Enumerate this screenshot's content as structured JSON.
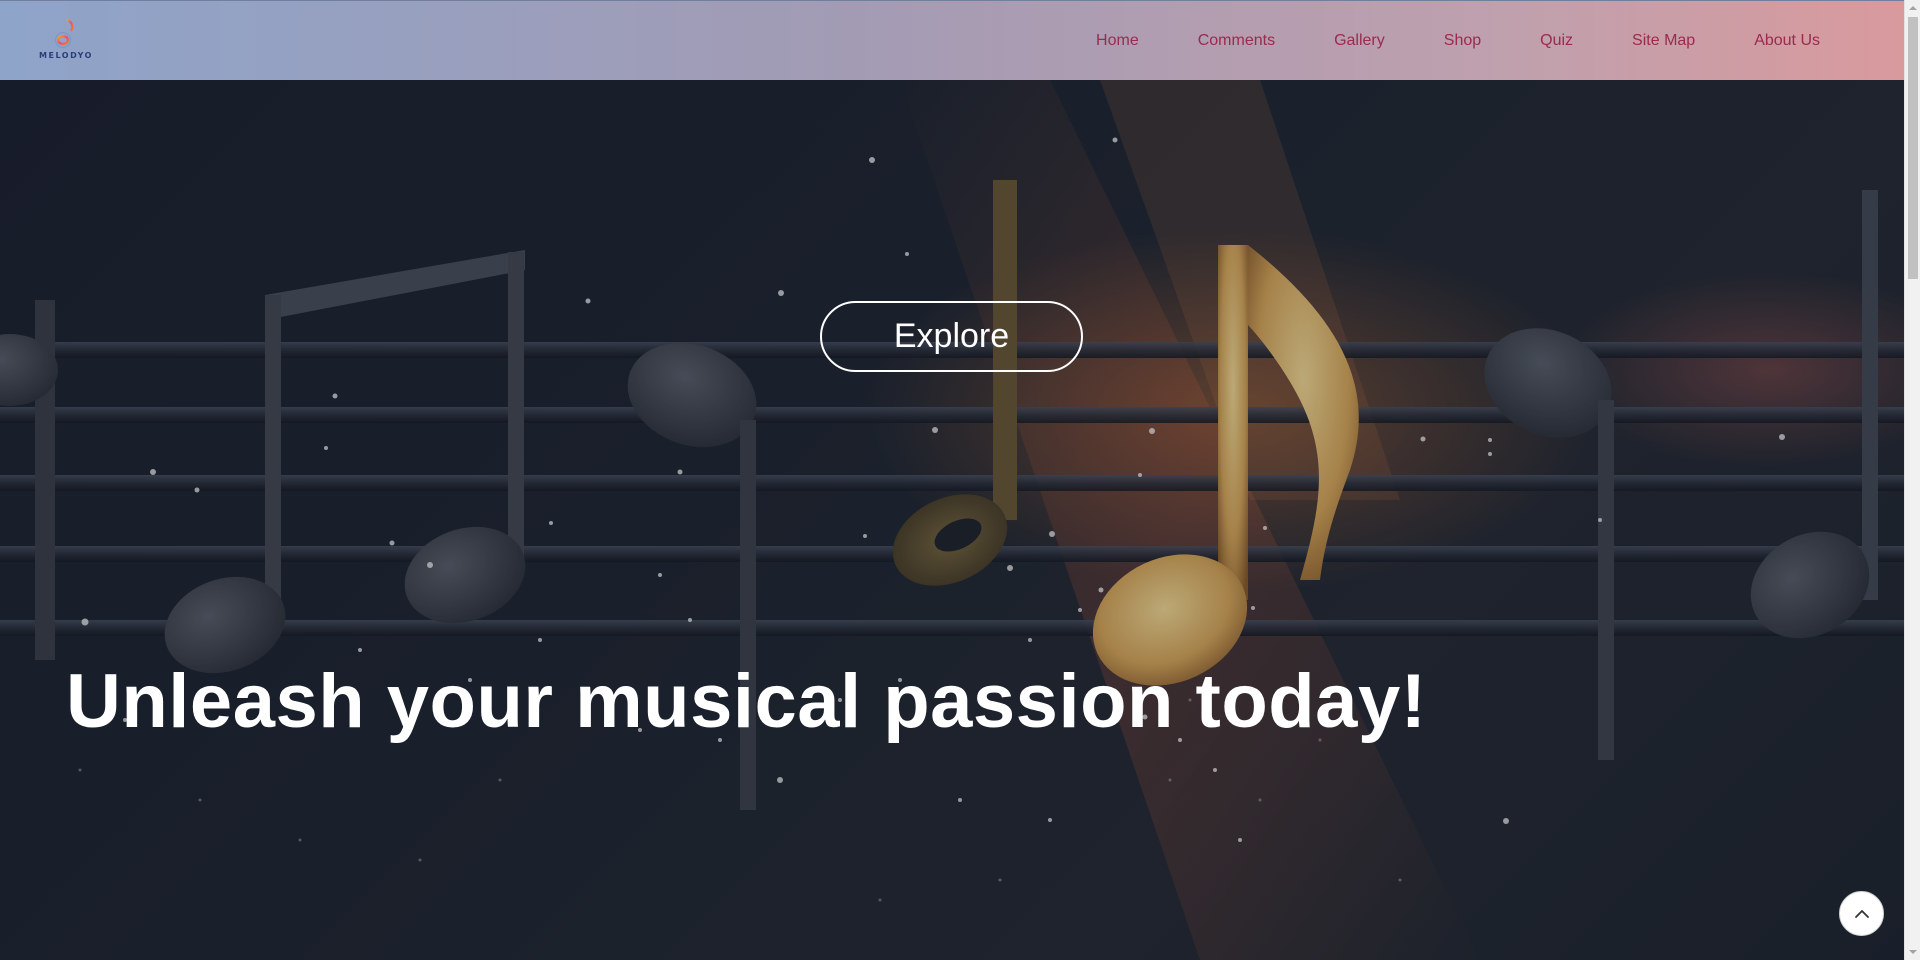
{
  "brand": {
    "logo_text": "MELODYO"
  },
  "nav": {
    "items": [
      {
        "label": "Home"
      },
      {
        "label": "Comments"
      },
      {
        "label": "Gallery"
      },
      {
        "label": "Shop"
      },
      {
        "label": "Quiz"
      },
      {
        "label": "Site Map"
      },
      {
        "label": "About Us"
      }
    ]
  },
  "hero": {
    "button_label": "Explore",
    "headline": "Unleash your musical passion today!",
    "background_icon": "music-notes-staff-image"
  },
  "scroll_to_top": {
    "icon": "chevron-up-icon"
  },
  "colors": {
    "nav_link": "#9b2a4e",
    "header_gradient_start": "#8ea4c9",
    "header_gradient_end": "#d99a9d",
    "headline": "#ffffff"
  }
}
